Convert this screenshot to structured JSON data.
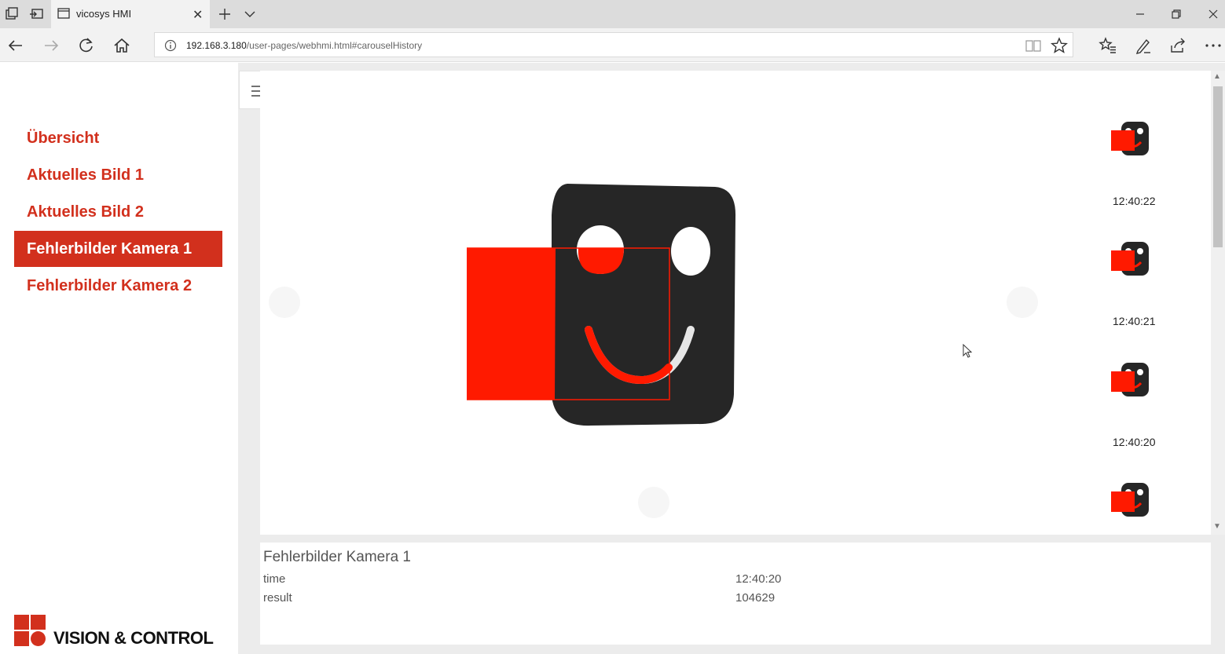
{
  "browser": {
    "tab_title": "vicosys HMI",
    "url_host": "192.168.3.180",
    "url_path": "/user-pages/webhmi.html#carouselHistory"
  },
  "sidebar": {
    "items": [
      {
        "label": "Übersicht"
      },
      {
        "label": "Aktuelles Bild 1"
      },
      {
        "label": "Aktuelles Bild 2"
      },
      {
        "label": "Fehlerbilder Kamera 1"
      },
      {
        "label": "Fehlerbilder Kamera 2"
      }
    ],
    "active_index": 3,
    "logo_text": "VISION & CONTROL"
  },
  "carousel": {
    "thumbnails": [
      {
        "time": "12:40:22"
      },
      {
        "time": "12:40:21"
      },
      {
        "time": "12:40:20"
      },
      {
        "time": ""
      }
    ]
  },
  "info": {
    "title": "Fehlerbilder Kamera 1",
    "rows": [
      {
        "label": "time",
        "value": "12:40:20"
      },
      {
        "label": "result",
        "value": "104629"
      }
    ]
  },
  "colors": {
    "accent": "#d2301d",
    "overlay": "#ff1a00",
    "part": "#262626"
  }
}
